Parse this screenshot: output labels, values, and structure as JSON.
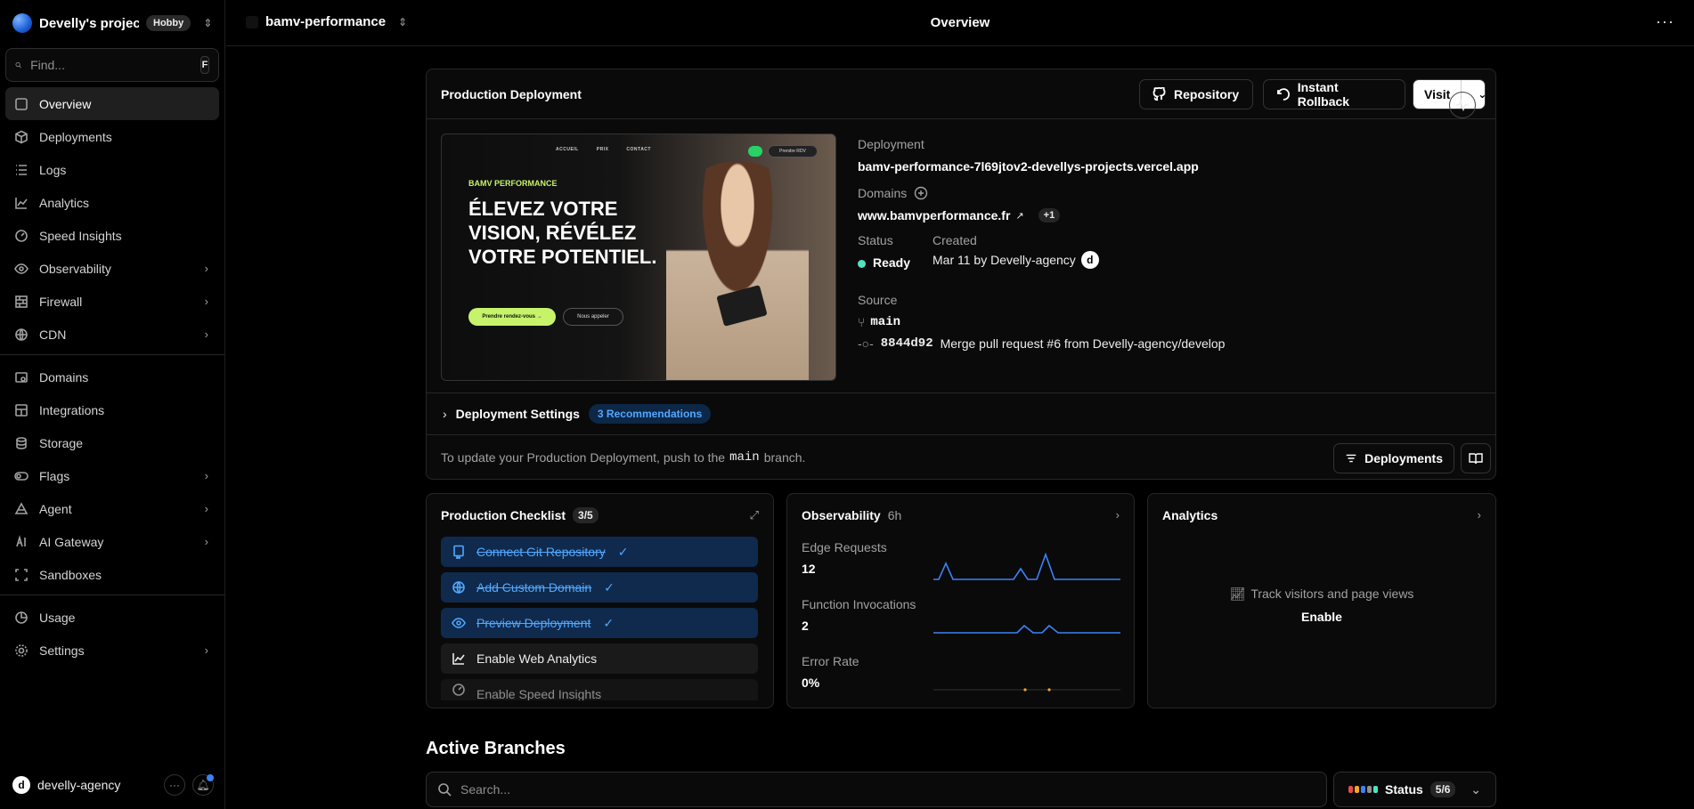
{
  "team": {
    "name": "Develly's projects",
    "plan": "Hobby"
  },
  "search": {
    "placeholder": "Find...",
    "shortcut": "F"
  },
  "nav": {
    "group1": [
      {
        "label": "Overview",
        "icon": "overview-icon",
        "active": true
      },
      {
        "label": "Deployments",
        "icon": "cube-icon"
      },
      {
        "label": "Logs",
        "icon": "list-icon"
      },
      {
        "label": "Analytics",
        "icon": "chart-icon"
      },
      {
        "label": "Speed Insights",
        "icon": "gauge-icon"
      },
      {
        "label": "Observability",
        "icon": "eye-icon",
        "chevron": true
      },
      {
        "label": "Firewall",
        "icon": "firewall-icon",
        "chevron": true
      },
      {
        "label": "CDN",
        "icon": "globe-icon",
        "chevron": true
      }
    ],
    "group2": [
      {
        "label": "Domains",
        "icon": "domain-icon"
      },
      {
        "label": "Integrations",
        "icon": "integrations-icon"
      },
      {
        "label": "Storage",
        "icon": "database-icon"
      },
      {
        "label": "Flags",
        "icon": "toggle-icon",
        "chevron": true
      },
      {
        "label": "Agent",
        "icon": "agent-icon",
        "chevron": true
      },
      {
        "label": "AI Gateway",
        "icon": "ai-icon",
        "chevron": true
      },
      {
        "label": "Sandboxes",
        "icon": "sandbox-icon"
      }
    ],
    "group3": [
      {
        "label": "Usage",
        "icon": "usage-icon"
      },
      {
        "label": "Settings",
        "icon": "gear-icon",
        "chevron": true
      }
    ]
  },
  "user": {
    "name": "develly-agency",
    "initial": "d"
  },
  "topbar": {
    "project": "bamv-performance",
    "title": "Overview"
  },
  "production": {
    "title": "Production Deployment",
    "repo_label": "Repository",
    "rollback_label": "Instant Rollback",
    "visit_label": "Visit",
    "preview": {
      "brand": "BAMV PERFORMANCE",
      "nav": [
        "ACCUEIL",
        "PRIX",
        "CONTACT"
      ],
      "rdv": "Prendre RDV",
      "headline": "ÉLEVEZ VOTRE VISION, RÉVÉLEZ VOTRE POTENTIEL.",
      "cta1": "Prendre rendez-vous →",
      "cta2": "Nous appeler"
    },
    "deployment_label": "Deployment",
    "deployment_url": "bamv-performance-7l69jtov2-devellys-projects.vercel.app",
    "domains_label": "Domains",
    "domain": "www.bamvperformance.fr",
    "domain_extra": "+1",
    "status_label": "Status",
    "status_value": "Ready",
    "created_label": "Created",
    "created_value": "Mar 11 by Develly-agency",
    "created_avatar": "d",
    "source_label": "Source",
    "branch": "main",
    "commit_hash": "8844d92",
    "commit_message": "Merge pull request #6 from Develly-agency/develop",
    "settings_label": "Deployment Settings",
    "recommendations": "3 Recommendations",
    "update_prefix": "To update your Production Deployment, push to the",
    "update_branch": "main",
    "update_suffix": "branch.",
    "deployments_btn": "Deployments"
  },
  "checklist": {
    "title": "Production Checklist",
    "count": "3/5",
    "items": [
      {
        "label": "Connect Git Repository",
        "done": true
      },
      {
        "label": "Add Custom Domain",
        "done": true
      },
      {
        "label": "Preview Deployment",
        "done": true
      },
      {
        "label": "Enable Web Analytics",
        "done": false
      },
      {
        "label": "Enable Speed Insights",
        "done": false
      }
    ]
  },
  "observability": {
    "title": "Observability",
    "range": "6h",
    "metrics": [
      {
        "label": "Edge Requests",
        "value": "12"
      },
      {
        "label": "Function Invocations",
        "value": "2"
      },
      {
        "label": "Error Rate",
        "value": "0%"
      }
    ]
  },
  "analytics": {
    "title": "Analytics",
    "message": "Track visitors and page views",
    "enable": "Enable"
  },
  "branches": {
    "title": "Active Branches",
    "search_placeholder": "Search...",
    "status_label": "Status",
    "status_count": "5/6"
  },
  "colors": {
    "accent_blue": "#52a8ff",
    "ready_green": "#50e3c2",
    "brand_lime": "#c6f36a"
  }
}
